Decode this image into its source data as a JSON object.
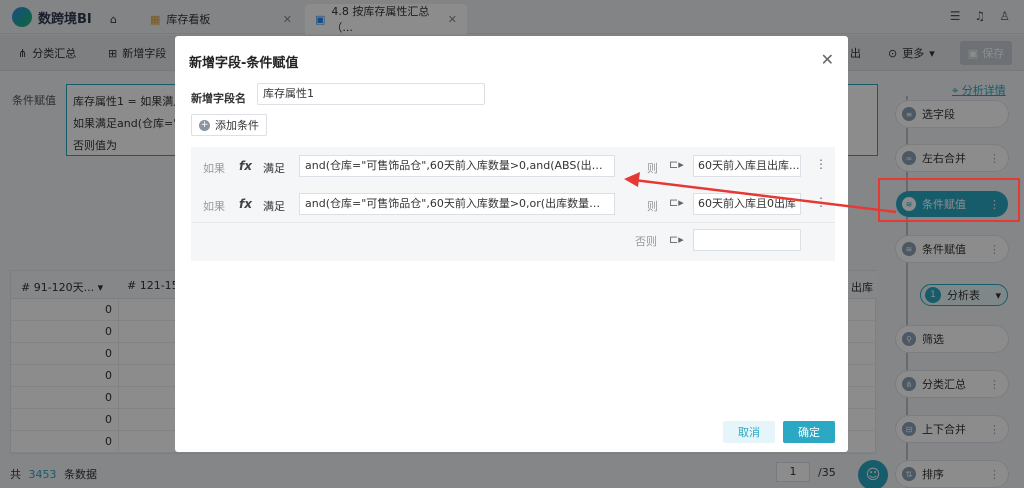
{
  "app": {
    "logo_text": "数跨境BI"
  },
  "tabs": [
    {
      "label": "库存看板"
    },
    {
      "label": "4.8 按库存属性汇总（..."
    }
  ],
  "toolbar": {
    "group_summary": "分类汇总",
    "add_field": "新增字段",
    "more": "更多",
    "save": "保存",
    "out_suffix": "出"
  },
  "background": {
    "cond_label": "条件赋值",
    "cond_lines": [
      "库存属性1 = 如果满足",
      "如果满足and(仓库=\"可",
      "否则值为"
    ],
    "columns": [
      "91-120天...",
      "121-150"
    ],
    "right_col_hint": "出库",
    "rows": [
      "0",
      "0",
      "0",
      "0",
      "0",
      "0",
      "0"
    ],
    "footer": {
      "prefix": "共",
      "count": "3453",
      "suffix": "条数据",
      "page": "1",
      "pages": "/35"
    }
  },
  "right_panel": {
    "link": "分析详情",
    "steps": [
      {
        "label": "选字段",
        "icon": "field-icon"
      },
      {
        "label": "左右合并",
        "icon": "merge-icon"
      },
      {
        "label": "条件赋值",
        "icon": "assign-icon",
        "active": true
      },
      {
        "label": "条件赋值",
        "icon": "assign-icon"
      },
      {
        "label": "筛选",
        "icon": "filter-icon"
      },
      {
        "label": "分类汇总",
        "icon": "group-icon"
      },
      {
        "label": "上下合并",
        "icon": "union-icon"
      },
      {
        "label": "排序",
        "icon": "sort-icon"
      }
    ],
    "analysis_table": {
      "num": "1",
      "label": "分析表"
    }
  },
  "modal": {
    "title": "新增字段-条件赋值",
    "field_name_label": "新增字段名",
    "field_name_value": "库存属性1",
    "add_condition": "添加条件",
    "rules": [
      {
        "if": "如果",
        "fx": "fx",
        "satisfy": "满足",
        "expr": "and(仓库=\"可售饰品仓\",60天前入库数量>0,and(ABS(出库数量)<...",
        "then": "则",
        "value": "60天前入库且出库..."
      },
      {
        "if": "如果",
        "fx": "fx",
        "satisfy": "满足",
        "expr": "and(仓库=\"可售饰品仓\",60天前入库数量>0,or(出库数量=0,ISNU...",
        "then": "则",
        "value": "60天前入库且0出库"
      }
    ],
    "else_label": "否则",
    "else_value": "",
    "cancel": "取消",
    "ok": "确定"
  },
  "colors": {
    "accent": "#2aa8c4",
    "annotation": "#e53935"
  }
}
